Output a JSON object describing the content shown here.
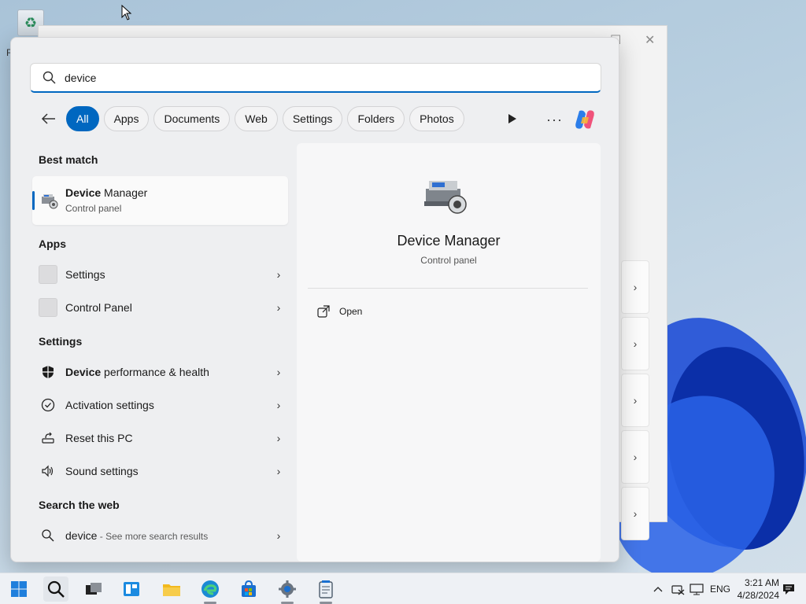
{
  "desktop": {
    "recycle_bin_label": "R"
  },
  "background_window": {
    "minimize": "☐",
    "close": "✕"
  },
  "search": {
    "query": "device",
    "filters": [
      "All",
      "Apps",
      "Documents",
      "Web",
      "Settings",
      "Folders",
      "Photos"
    ],
    "active_filter": "All",
    "more_label": "···"
  },
  "results": {
    "best_match_heading": "Best match",
    "best_match": {
      "title_bold": "Device",
      "title_rest": " Manager",
      "subtitle": "Control panel"
    },
    "apps_heading": "Apps",
    "apps": [
      {
        "label": "Settings"
      },
      {
        "label": "Control Panel"
      }
    ],
    "settings_heading": "Settings",
    "settings": [
      {
        "bold": "Device",
        "rest": " performance & health",
        "icon": "shield-icon"
      },
      {
        "bold": "",
        "rest": "Activation settings",
        "icon": "check-circle-icon"
      },
      {
        "bold": "",
        "rest": "Reset this PC",
        "icon": "reset-pc-icon"
      },
      {
        "bold": "",
        "rest": "Sound settings",
        "icon": "speaker-icon"
      }
    ],
    "web_heading": "Search the web",
    "web": {
      "query": "device",
      "suffix": " - See more search results"
    }
  },
  "detail": {
    "title": "Device Manager",
    "subtitle": "Control panel",
    "open_label": "Open"
  },
  "taskbar": {
    "lang": "ENG",
    "time": "3:21 AM",
    "date": "4/28/2024"
  },
  "colors": {
    "accent": "#0067c0"
  }
}
